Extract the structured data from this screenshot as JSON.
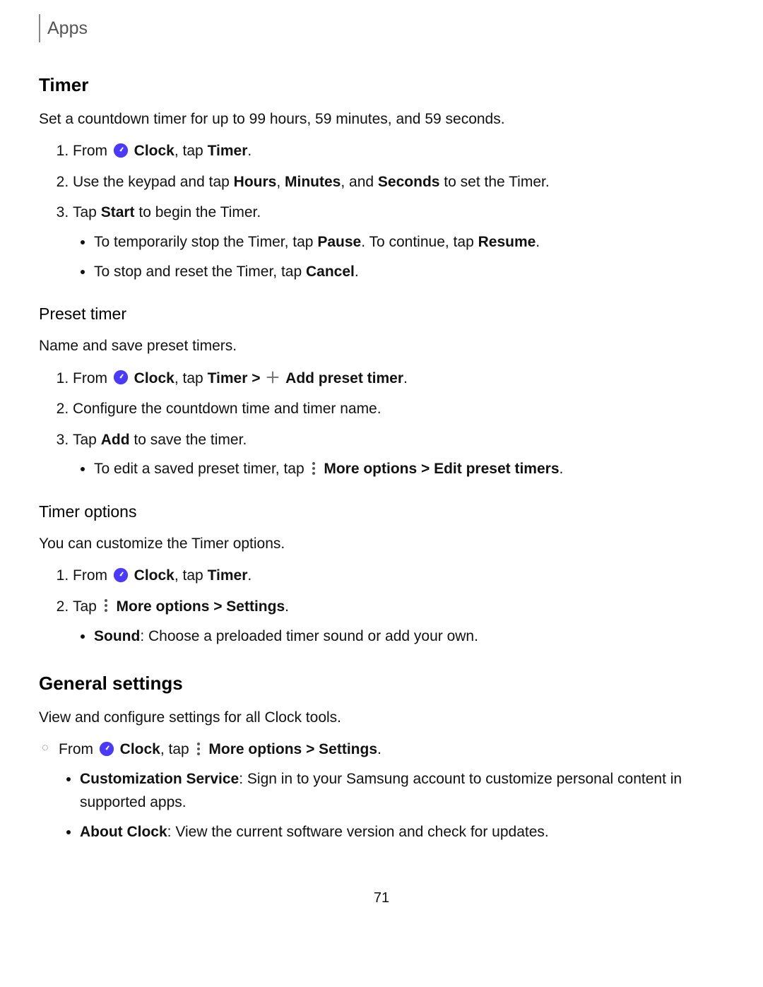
{
  "breadcrumb": "Apps",
  "page_number": "71",
  "timer": {
    "title": "Timer",
    "intro": "Set a countdown timer for up to 99 hours, 59 minutes, and 59 seconds.",
    "step1_a": "From ",
    "step1_b": "Clock",
    "step1_c": ", tap ",
    "step1_d": "Timer",
    "step1_e": ".",
    "step2_a": "Use the keypad and tap ",
    "step2_b": "Hours",
    "step2_c": ", ",
    "step2_d": "Minutes",
    "step2_e": ", and ",
    "step2_f": "Seconds",
    "step2_g": " to set the Timer.",
    "step3_a": "Tap ",
    "step3_b": "Start",
    "step3_c": " to begin the Timer.",
    "bullet1_a": "To temporarily stop the Timer, tap ",
    "bullet1_b": "Pause",
    "bullet1_c": ". To continue, tap ",
    "bullet1_d": "Resume",
    "bullet1_e": ".",
    "bullet2_a": "To stop and reset the Timer, tap ",
    "bullet2_b": "Cancel",
    "bullet2_c": "."
  },
  "preset": {
    "title": "Preset timer",
    "intro": "Name and save preset timers.",
    "step1_a": "From ",
    "step1_b": "Clock",
    "step1_c": ", tap ",
    "step1_d": "Timer",
    "step1_e": " > ",
    "step1_f": "Add preset timer",
    "step1_g": ".",
    "step2": "Configure the countdown time and timer name.",
    "step3_a": "Tap ",
    "step3_b": "Add",
    "step3_c": " to save the timer.",
    "bullet1_a": "To edit a saved preset timer, tap ",
    "bullet1_b": "More options > Edit preset timers",
    "bullet1_c": "."
  },
  "options": {
    "title": "Timer options",
    "intro": "You can customize the Timer options.",
    "step1_a": "From ",
    "step1_b": "Clock",
    "step1_c": ", tap ",
    "step1_d": "Timer",
    "step1_e": ".",
    "step2_a": "Tap ",
    "step2_b": "More options > Settings",
    "step2_c": ".",
    "bullet1_a": "Sound",
    "bullet1_b": ": Choose a preloaded timer sound or add your own."
  },
  "general": {
    "title": "General settings",
    "intro": "View and configure settings for all Clock tools.",
    "step1_a": "From ",
    "step1_b": "Clock",
    "step1_c": ", tap ",
    "step1_d": "More options > Settings",
    "step1_e": ".",
    "bullet1_a": "Customization Service",
    "bullet1_b": ": Sign in to your Samsung account to customize personal content in supported apps.",
    "bullet2_a": "About Clock",
    "bullet2_b": ": View the current software version and check for updates."
  }
}
